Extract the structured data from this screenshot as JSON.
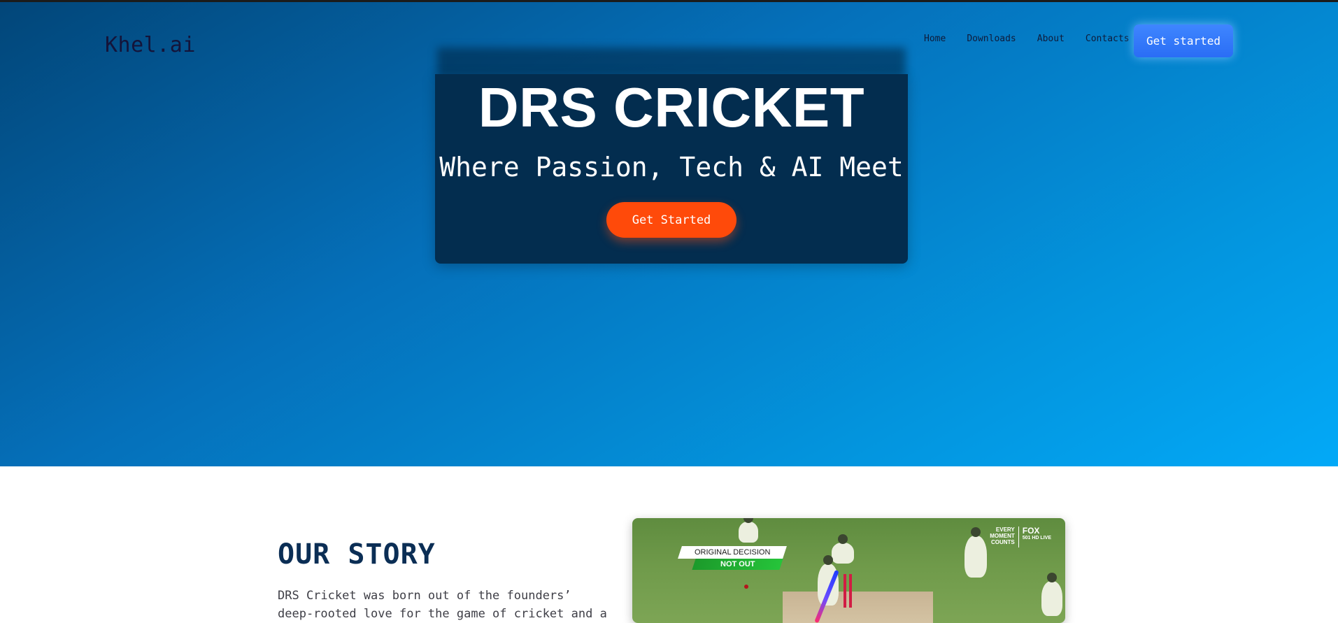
{
  "brand": {
    "logo": "Khel.ai"
  },
  "nav": {
    "links": [
      "Home",
      "Downloads",
      "About",
      "Contacts"
    ],
    "cta_label": "Get started"
  },
  "hero": {
    "title": "DRS CRICKET",
    "subtitle": "Where Passion, Tech & AI Meet",
    "cta_label": "Get Started"
  },
  "story": {
    "heading": "OUR STORY",
    "text": "DRS Cricket was born out of the founders’ deep-rooted love for the game of cricket and a"
  },
  "story_image": {
    "decision_label": "ORIGINAL DECISION",
    "decision_value": "NOT OUT",
    "broadcaster_tagline": "EVERY MOMENT COUNTS",
    "broadcaster_channel": "FOX",
    "broadcaster_sub": "501 HD LIVE"
  },
  "colors": {
    "hero_gradient_start": "#024679",
    "hero_gradient_end": "#03a9f7",
    "hero_card": "#032d4f",
    "hero_cta": "#ff4a0a",
    "nav_cta": "#2a6df5",
    "heading": "#0b2e55"
  }
}
